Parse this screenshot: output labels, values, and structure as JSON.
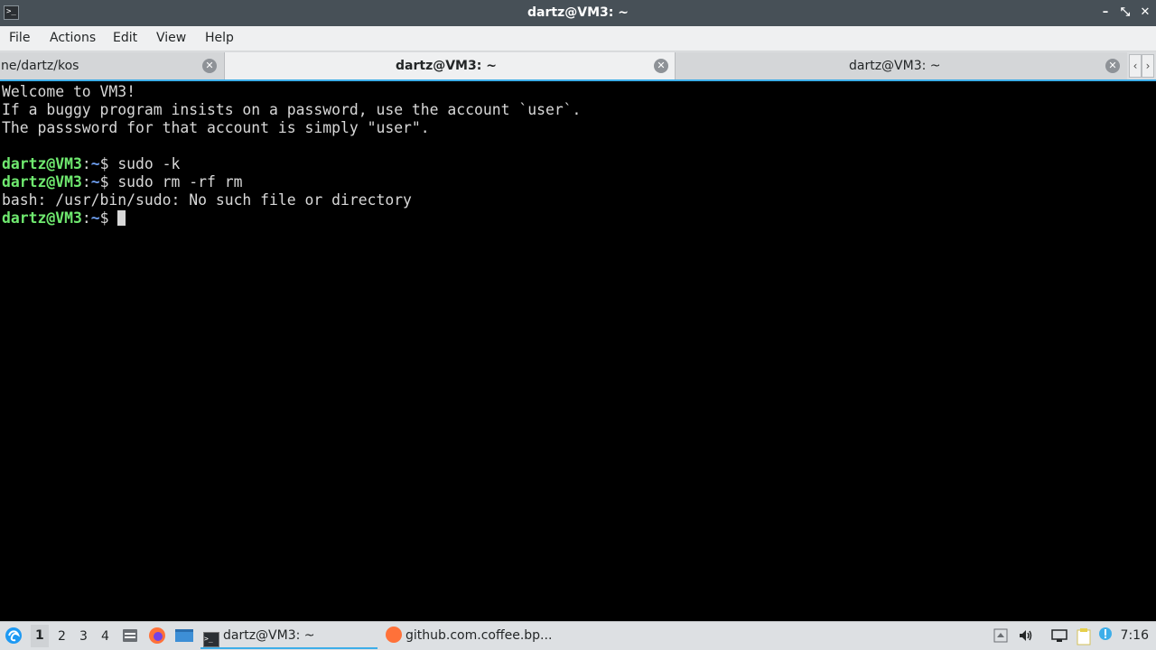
{
  "window": {
    "title": "dartz@VM3: ~",
    "app_icon_text": ">_",
    "minimize": "–",
    "maximize": "⤡",
    "close": "✕"
  },
  "menu": [
    "File",
    "Actions",
    "Edit",
    "View",
    "Help"
  ],
  "tabs": [
    {
      "label": "ne/dartz/kos",
      "active": false
    },
    {
      "label": "dartz@VM3: ~",
      "active": true
    },
    {
      "label": "dartz@VM3: ~",
      "active": false
    }
  ],
  "tab_close_glyph": "✕",
  "tab_scroll": {
    "left": "‹",
    "right": "›"
  },
  "terminal": {
    "welcome": [
      "Welcome to VM3!",
      "If a buggy program insists on a password, use the account `user`.",
      "The passsword for that account is simply \"user\"."
    ],
    "prompt": {
      "user": "dartz@VM3",
      "sep": ":",
      "path": "~",
      "symbol": "$"
    },
    "commands": [
      "sudo -k",
      "sudo rm -rf rm"
    ],
    "output": "bash: /usr/bin/sudo: No such file or directory",
    "colors": {
      "prompt_user": "#6fe96f",
      "prompt_path": "#6e9ff0",
      "text": "#d8d8d8",
      "background": "#000000"
    }
  },
  "taskbar": {
    "workspaces": [
      "1",
      "2",
      "3",
      "4"
    ],
    "tasks": [
      {
        "label": "dartz@VM3: ~",
        "icon": "terminal-icon",
        "active": true
      },
      {
        "label": "github.com.coffee.bp...",
        "icon": "firefox-icon",
        "active": false
      }
    ],
    "clock": "7:16",
    "accent": "#3daee9"
  }
}
